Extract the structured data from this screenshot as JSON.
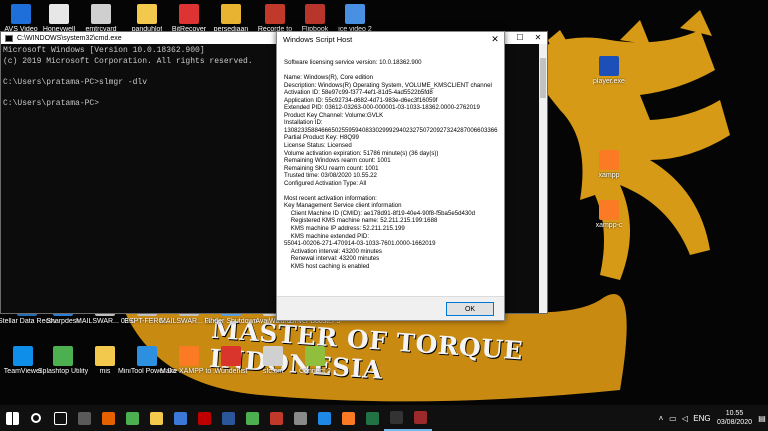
{
  "colors": {
    "wallpaper_gold": "#d69a16",
    "console_bg": "#0c0c0c",
    "taskbar_bg": "#101010",
    "accent": "#0078d7"
  },
  "desktop": {
    "top_icons": [
      {
        "label": "AVS Video",
        "icon": "avs-video-icon",
        "color": "#1e6fd9"
      },
      {
        "label": "Honeywell",
        "icon": "honeywell-icon",
        "color": "#e7e7e7"
      },
      {
        "label": "emtrcvard",
        "icon": "file-icon",
        "color": "#cfcfcf"
      },
      {
        "label": "panduhlot",
        "icon": "folder-icon",
        "color": "#f2c94c"
      },
      {
        "label": "BitRecover",
        "icon": "bitrecover-icon",
        "color": "#d33"
      },
      {
        "label": "persediaan",
        "icon": "folder-icon",
        "color": "#e8b331"
      },
      {
        "label": "Recorde to",
        "icon": "recorder-icon",
        "color": "#c0392b"
      },
      {
        "label": "Flipbook",
        "icon": "book-icon",
        "color": "#b7352a"
      },
      {
        "label": "ice video 2",
        "icon": "video-icon",
        "color": "#4a90e2"
      }
    ],
    "right_icons": [
      {
        "label": "player.exe",
        "icon": "player-icon",
        "color": "#1d4fb8"
      },
      {
        "label": "xampp",
        "icon": "xampp-icon",
        "color": "#fb7a24"
      },
      {
        "label": "xampp-c",
        "icon": "xampp-icon",
        "color": "#fb7a24"
      }
    ],
    "row1_icons": [
      {
        "label": "Stellar Data Recovery P...",
        "icon": "stellar-icon",
        "color": "#1f6fb5"
      },
      {
        "label": "Sharpdesk",
        "icon": "sharpdesk-icon",
        "color": "#2b7cd3"
      },
      {
        "label": "MAILSWAR... 03-00",
        "icon": "file-icon",
        "color": "#bfbfbf"
      },
      {
        "label": "ESPT-FERG...",
        "icon": "file-icon",
        "color": "#bfbfbf"
      },
      {
        "label": "MAILSWAR... 02-00",
        "icon": "file-icon",
        "color": "#bfbfbf"
      },
      {
        "label": "Finger Shutdown",
        "icon": "finger-icon",
        "color": "#5aa0e0"
      },
      {
        "label": "AvaiWizard",
        "icon": "wizard-icon",
        "color": "#d0d0d0"
      },
      {
        "label": "Driver Booster 5",
        "icon": "driver-booster-icon",
        "color": "#e04b1a"
      }
    ],
    "row2_icons": [
      {
        "label": "TeamViewer",
        "icon": "teamviewer-icon",
        "color": "#0e8ee9"
      },
      {
        "label": "Splashtop Utility",
        "icon": "splashtop-icon",
        "color": "#4caf50"
      },
      {
        "label": "mis",
        "icon": "folder-icon",
        "color": "#f2c94c"
      },
      {
        "label": "MiniTool Power Dat...",
        "icon": "minitool-icon",
        "color": "#2d8fe0"
      },
      {
        "label": "Make XAMPP to ...",
        "icon": "xampp-icon",
        "color": "#fb7a24"
      },
      {
        "label": "Wunderlist",
        "icon": "wunderlist-icon",
        "color": "#d9352c"
      },
      {
        "label": "sfc.cm",
        "icon": "file-icon",
        "color": "#d0d0d0"
      },
      {
        "label": "Connect 2",
        "icon": "connect-icon",
        "color": "#8fbf3c"
      }
    ],
    "wallpaper_text": "MASTER OF TORQUE INDONESIA"
  },
  "cmd": {
    "title": "C:\\WINDOWS\\system32\\cmd.exe",
    "lines": [
      "Microsoft Windows [Version 10.0.18362.900]",
      "(c) 2019 Microsoft Corporation. All rights reserved.",
      "",
      "C:\\Users\\pratama-PC>slmgr -dlv",
      "",
      "C:\\Users\\pratama-PC>"
    ]
  },
  "dialog": {
    "title": "Windows Script Host",
    "lines": [
      "Software licensing service version: 10.0.18362.900",
      "",
      "Name: Windows(R), Core edition",
      "Description: Windows(R) Operating System, VOLUME_KMSCLIENT channel",
      "Activation ID: 58e97c99-f377-4ef1-81d5-4ad5522b5fd8",
      "Application ID: 55c92734-d682-4d71-983e-d6ec3f16059f",
      "Extended PID: 03612-03263-000-000001-03-1033-18362.0000-2762019",
      "Product Key Channel: Volume:GVLK",
      "Installation ID:",
      "130823358846665025595940833029992940232750720927324287006603366",
      "Partial Product Key: H8Q99",
      "License Status: Licensed",
      "Volume activation expiration: 51786 minute(s) (36 day(s))",
      "Remaining Windows rearm count: 1001",
      "Remaining SKU rearm count: 1001",
      "Trusted time: 03/08/2020 10.55.22",
      "Configured Activation Type: All",
      "",
      "Most recent activation information:",
      "Key Management Service client information",
      "    Client Machine ID (CMID): ae178d91-8f19-40e4-90f8-f5ba5e5d430d",
      "    Registered KMS machine name: 52.211.215.199:1688",
      "    KMS machine IP address: 52.211.215.199",
      "    KMS machine extended PID:",
      "55041-00206-271-470914-03-1033-7601.0000-1662019",
      "    Activation interval: 43200 minutes",
      "    Renewal interval: 43200 minutes",
      "    KMS host caching is enabled"
    ],
    "ok_label": "OK"
  },
  "taskbar": {
    "icons": [
      {
        "name": "start-button",
        "color": "#ffffff"
      },
      {
        "name": "search-icon",
        "color": "#ffffff"
      },
      {
        "name": "task-view-icon",
        "color": "#ffffff"
      },
      {
        "name": "calculator-icon",
        "color": "#5a5a5a"
      },
      {
        "name": "firefox-icon",
        "color": "#e66000"
      },
      {
        "name": "chrome-icon",
        "color": "#4caf50"
      },
      {
        "name": "file-explorer-icon",
        "color": "#f2c94c"
      },
      {
        "name": "photos-icon",
        "color": "#3b78d8"
      },
      {
        "name": "filezilla-icon",
        "color": "#bf0000"
      },
      {
        "name": "word-icon",
        "color": "#2b579a"
      },
      {
        "name": "chrome-icon",
        "color": "#4caf50"
      },
      {
        "name": "recorder-icon",
        "color": "#c0392b"
      },
      {
        "name": "calendar-icon",
        "color": "#8a8a8a"
      },
      {
        "name": "vscode-icon",
        "color": "#1e88e5"
      },
      {
        "name": "xampp-icon",
        "color": "#fb7a24"
      },
      {
        "name": "excel-icon",
        "color": "#217346"
      },
      {
        "name": "cmd-icon",
        "color": "#333333"
      },
      {
        "name": "script-host-icon",
        "color": "#9c2a2a"
      }
    ],
    "tray": {
      "language": "ENG",
      "time": "10.55",
      "date": "03/08/2020"
    }
  }
}
